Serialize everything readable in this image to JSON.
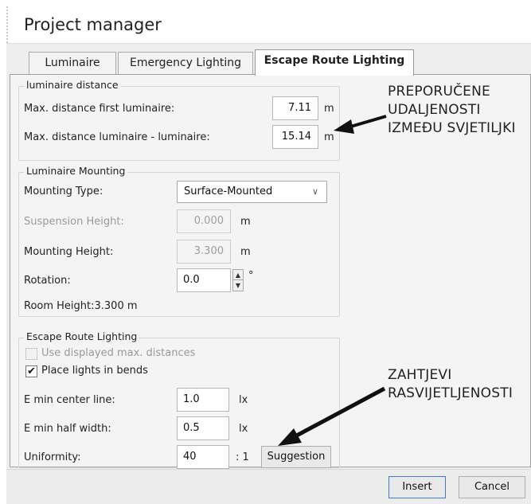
{
  "window": {
    "title": "Project manager"
  },
  "tabs": [
    {
      "label": "Luminaire"
    },
    {
      "label": "Emergency Lighting"
    },
    {
      "label": "Escape Route Lighting"
    }
  ],
  "distance_group": {
    "title": "luminaire distance",
    "first_label": "Max. distance first luminaire:",
    "first_value": "7.11",
    "first_unit": "m",
    "between_label": "Max. distance luminaire - luminaire:",
    "between_value": "15.14",
    "between_unit": "m"
  },
  "mounting_group": {
    "title": "Luminaire Mounting",
    "type_label": "Mounting Type:",
    "type_value": "Surface-Mounted",
    "suspension_label": "Suspension Height:",
    "suspension_value": "0.000",
    "suspension_unit": "m",
    "mounting_label": "Mounting Height:",
    "mounting_value": "3.300",
    "mounting_unit": "m",
    "rotation_label": "Rotation:",
    "rotation_value": "0.0",
    "rotation_unit": "°",
    "room_height": "Room Height:3.300 m"
  },
  "escape_group": {
    "title": "Escape Route Lighting",
    "use_distances_label": "Use displayed max. distances",
    "use_distances_checked": false,
    "place_bends_label": "Place lights in bends",
    "place_bends_checked": true,
    "emin_center_label": "E min center line:",
    "emin_center_value": "1.0",
    "emin_center_unit": "lx",
    "emin_half_label": "E min half width:",
    "emin_half_value": "0.5",
    "emin_half_unit": "lx",
    "uniformity_label": "Uniformity:",
    "uniformity_value": "40",
    "uniformity_unit": ": 1",
    "suggestion_label": "Suggestion"
  },
  "annotations": {
    "distance_note": [
      "PREPORUČENE",
      "UDALJENOSTI",
      "IZMEĐU SVJETILJKI"
    ],
    "lighting_note": [
      "ZAHTJEVI",
      "RASVIJETLJENOSTI"
    ]
  },
  "footer": {
    "insert_label": "Insert",
    "cancel_label": "Cancel"
  },
  "icons": {
    "dropdown": "chevron-down-icon",
    "spin_up": "arrow-up-icon",
    "spin_down": "arrow-down-icon",
    "check": "checkmark-icon"
  }
}
